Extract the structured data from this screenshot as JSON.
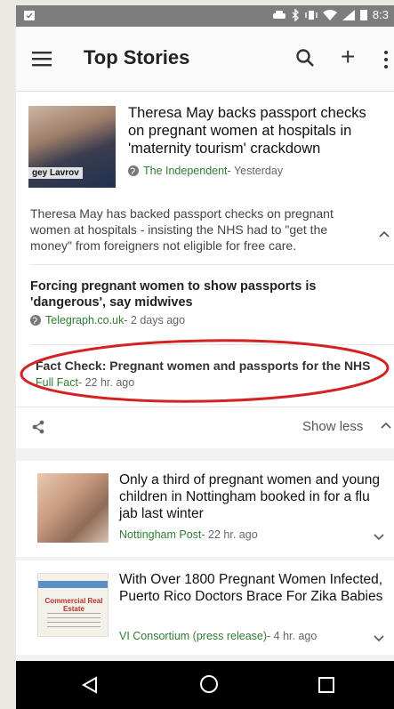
{
  "status_bar": {
    "time": "8:3"
  },
  "app_bar": {
    "title": "Top Stories"
  },
  "story1": {
    "image_caption": "gey Lavrov",
    "headline": "Theresa May backs passport checks on pregnant women at hospitals in 'maternity tourism' crackdown",
    "source": "The Independent",
    "time": " - Yesterday",
    "summary": "Theresa May has backed passport checks on pregnant women at hospitals - insisting the NHS had to \"get the money\" from foreigners not eligible for free care."
  },
  "story2": {
    "headline": "Forcing pregnant women to show passports is 'dangerous', say midwives",
    "source": "Telegraph.co.uk",
    "time": " - 2 days ago"
  },
  "story3": {
    "headline": "Fact Check: Pregnant women and passports for the NHS",
    "source": "Full Fact",
    "time": " - 22 hr. ago"
  },
  "share_bar": {
    "show_less": "Show less"
  },
  "story4": {
    "headline": "Only a third of pregnant women and young children in Nottingham booked in for a flu jab last winter",
    "source": "Nottingham Post",
    "time": " - 22 hr. ago"
  },
  "story5": {
    "thumb_text": "Commercial Real Estate",
    "headline": "With Over 1800 Pregnant Women Infected, Puerto Rico Doctors Brace For Zika Babies",
    "source": "VI Consortium (press release)",
    "time": " - 4 hr. ago"
  },
  "colors": {
    "source_green": "#2f7d32",
    "annotation_red": "#d32222"
  },
  "icons": [
    "menu-icon",
    "search-icon",
    "plus-icon",
    "more-icon",
    "globe-icon",
    "chevron-up-icon",
    "share-icon",
    "chevron-down-icon",
    "back-icon",
    "home-icon",
    "recents-icon"
  ]
}
